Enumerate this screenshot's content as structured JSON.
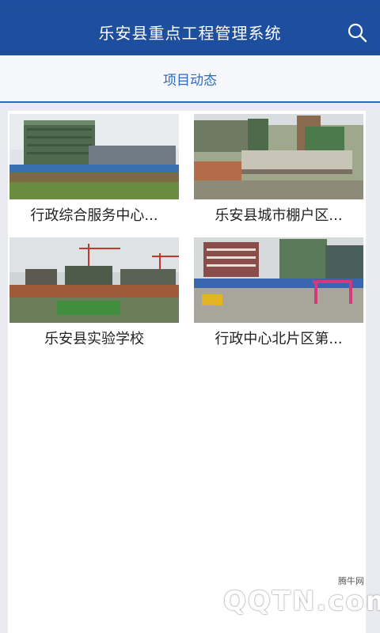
{
  "app_bar": {
    "title": "乐安县重点工程管理系统",
    "search_icon": "search-icon"
  },
  "tabs": [
    {
      "label": "项目动态",
      "active": true
    }
  ],
  "projects": [
    {
      "title": "行政综合服务中心...",
      "image": "construction-site-photo"
    },
    {
      "title": "乐安县城市棚户区...",
      "image": "construction-site-photo"
    },
    {
      "title": "乐安县实验学校",
      "image": "construction-site-photo"
    },
    {
      "title": "行政中心北片区第...",
      "image": "construction-site-photo"
    }
  ],
  "watermark": {
    "logo_text": "QQTN.com",
    "sub_text": "腾牛网"
  },
  "colors": {
    "app_bar": "#1d4f9e",
    "tab_accent": "#2b6bbf",
    "background": "#e9ebf0"
  }
}
